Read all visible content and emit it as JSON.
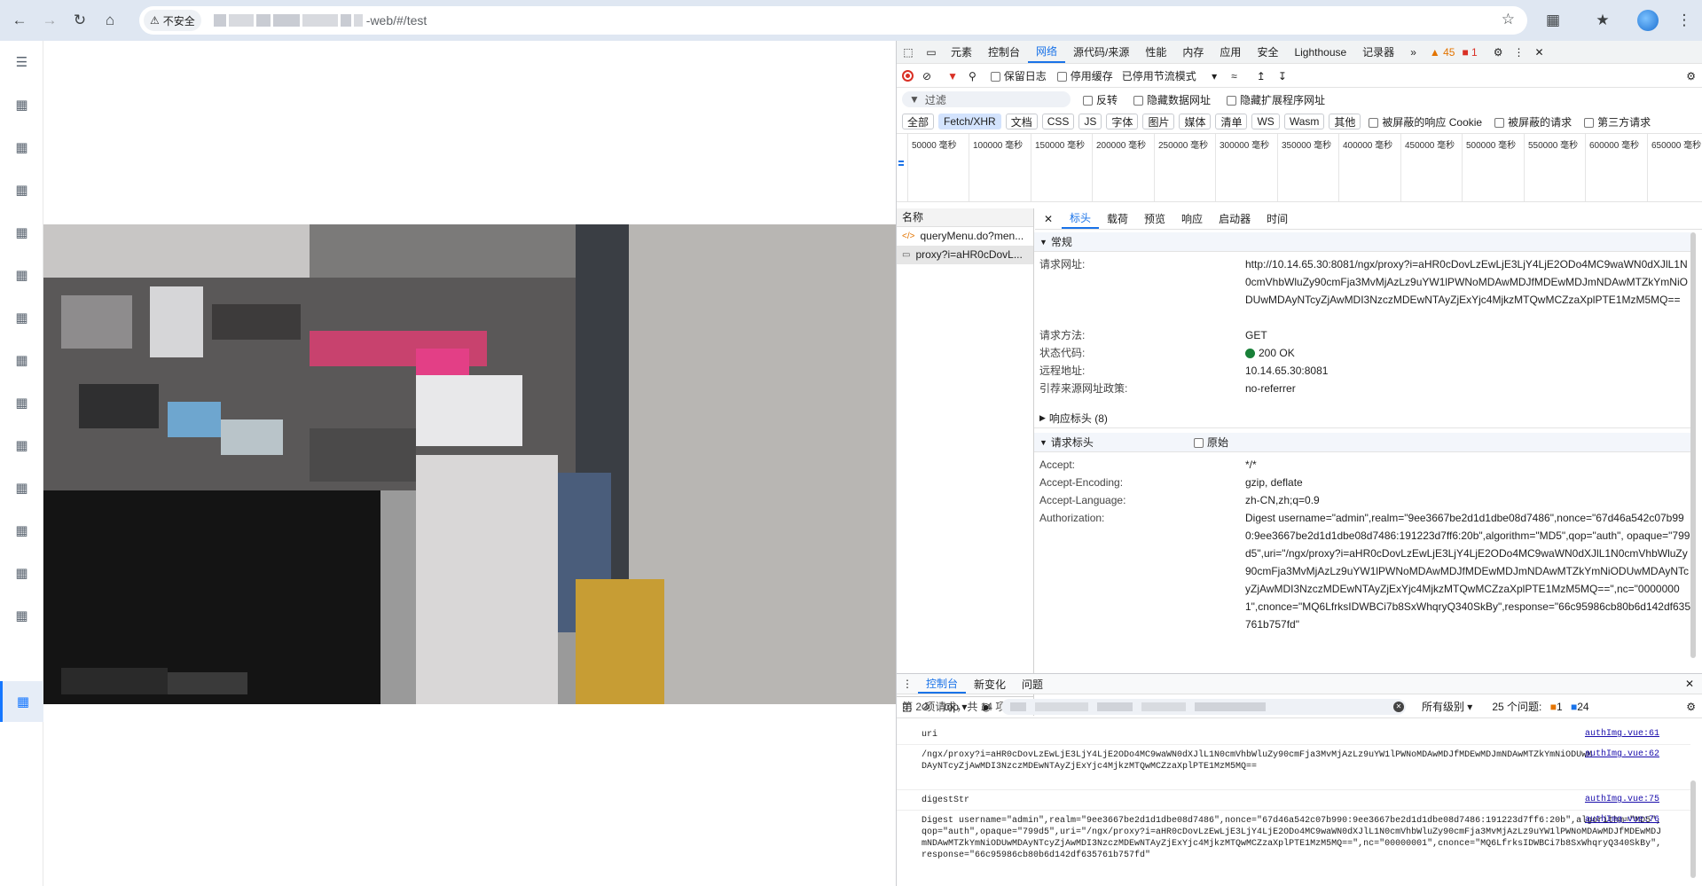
{
  "browser": {
    "insecure_label": "不安全",
    "url_tail": "-web/#/test"
  },
  "devtools": {
    "tabs": [
      "元素",
      "控制台",
      "网络",
      "源代码/来源",
      "性能",
      "内存",
      "应用",
      "安全",
      "Lighthouse",
      "记录器"
    ],
    "selected_tab": "网络",
    "more_tabs": "»",
    "warn_count": "45",
    "error_count": "1",
    "network_toolbar": {
      "preserve_log": "保留日志",
      "disable_cache": "停用缓存",
      "throttle": "已停用节流模式"
    },
    "filter": {
      "placeholder": "过滤",
      "invert": "反转",
      "hide_data_urls": "隐藏数据网址",
      "hide_extension_urls": "隐藏扩展程序网址"
    },
    "type_chips": [
      "全部",
      "Fetch/XHR",
      "文档",
      "CSS",
      "JS",
      "字体",
      "图片",
      "媒体",
      "清单",
      "WS",
      "Wasm",
      "其他"
    ],
    "selected_chip": "Fetch/XHR",
    "blocked_cookies": "被屏蔽的响应 Cookie",
    "blocked_requests": "被屏蔽的请求",
    "third_party": "第三方请求",
    "timeline_ticks": [
      "50000 毫秒",
      "100000 毫秒",
      "150000 毫秒",
      "200000 毫秒",
      "250000 毫秒",
      "300000 毫秒",
      "350000 毫秒",
      "400000 毫秒",
      "450000 毫秒",
      "500000 毫秒",
      "550000 毫秒",
      "600000 毫秒",
      "650000 毫秒"
    ],
    "request_list": {
      "header": "名称",
      "items": [
        "queryMenu.do?men...",
        "proxy?i=aHR0cDovL..."
      ],
      "footer": "第 2 项请求，共 14 项"
    },
    "detail_tabs": [
      "标头",
      "载荷",
      "预览",
      "响应",
      "启动器",
      "时间"
    ],
    "selected_detail_tab": "标头",
    "general": {
      "title": "常规",
      "rows": [
        {
          "k": "请求网址:",
          "v": "http://10.14.65.30:8081/ngx/proxy?i=aHR0cDovLzEwLjE3LjY4LjE2ODo4MC9waWN0dXJlL1N0cmVhbWluZy90cmFja3MvMjAzLz9uYW1lPWNoMDAwMDJfMDEwMDJmNDAwMTZkYmNiODUwMDAyNTcyZjAwMDI3NzczMDEwNTAyZjExYjc4MjkzMTQwMCZzaXplPTE1MzM5MQ=="
        },
        {
          "k": "请求方法:",
          "v": "GET"
        },
        {
          "k": "状态代码:",
          "v": "200 OK"
        },
        {
          "k": "远程地址:",
          "v": "10.14.65.30:8081"
        },
        {
          "k": "引荐来源网址政策:",
          "v": "no-referrer"
        }
      ]
    },
    "response_headers": "响应标头 (8)",
    "request_headers": {
      "title": "请求标头",
      "raw_label": "原始",
      "rows": [
        {
          "k": "Accept:",
          "v": "*/*"
        },
        {
          "k": "Accept-Encoding:",
          "v": "gzip, deflate"
        },
        {
          "k": "Accept-Language:",
          "v": "zh-CN,zh;q=0.9"
        },
        {
          "k": "Authorization:",
          "v": "Digest username=\"admin\",realm=\"9ee3667be2d1d1dbe08d7486\",nonce=\"67d46a542c07b990:9ee3667be2d1d1dbe08d7486:191223d7ff6:20b\",algorithm=\"MD5\",qop=\"auth\", opaque=\"799d5\",uri=\"/ngx/proxy?i=aHR0cDovLzEwLjE3LjY4LjE2ODo4MC9waWN0dXJlL1N0cmVhbWluZy90cmFja3MvMjAzLz9uYW1lPWNoMDAwMDJfMDEwMDJmNDAwMTZkYmNiODUwMDAyNTcyZjAwMDI3NzczMDEwNTAyZjExYjc4MjkzMTQwMCZzaXplPTE1MzM5MQ==\",nc=\"00000001\",cnonce=\"MQ6LfrksIDWBCi7b8SxWhqryQ340SkBy\",response=\"66c95986cb80b6d142df635761b757fd\""
        }
      ]
    },
    "drawer": {
      "tabs": [
        "控制台",
        "新变化",
        "问题"
      ],
      "selected": "控制台",
      "context": "top",
      "level": "所有级别",
      "issues_label": "25 个问题:",
      "issues_err": "1",
      "issues_info": "24",
      "lines": [
        {
          "text": "uri",
          "src": "authImg.vue:61"
        },
        {
          "text": "/ngx/proxy?i=aHR0cDovLzEwLjE3LjY4LjE2ODo4MC9waWN0dXJlL1N0cmVhbWluZy90cmFja3MvMjAzLz9uYW1lPWNoMDAwMDJfMDEwMDJmNDAwMTZkYmNiODUwMDAyNTcyZjAwMDI3NzczMDEwNTAyZjExYjc4MjkzMTQwMCZzaXplPTE1MzM5MQ==",
          "src": "authImg.vue:62"
        },
        {
          "text": "digestStr",
          "src": "authImg.vue:75"
        },
        {
          "text": "Digest username=\"admin\",realm=\"9ee3667be2d1d1dbe08d7486\",nonce=\"67d46a542c07b990:9ee3667be2d1d1dbe08d7486:191223d7ff6:20b\",algorithm=\"MD5\",qop=\"auth\",opaque=\"799d5\",uri=\"/ngx/proxy?i=aHR0cDovLzEwLjE3LjY4LjE2ODo4MC9waWN0dXJlL1N0cmVhbWluZy90cmFja3MvMjAzLz9uYW1lPWNoMDAwMDJfMDEwMDJmNDAwMTZkYmNiODUwMDAyNTcyZjAwMDI3NzczMDEwNTAyZjExYjc4MjkzMTQwMCZzaXplPTE1MzM5MQ==\",nc=\"00000001\",cnonce=\"MQ6LfrksIDWBCi7b8SxWhqryQ340SkBy\",response=\"66c95986cb80b6d142df635761b757fd\"",
          "src": "authImg.vue:76"
        }
      ]
    }
  }
}
